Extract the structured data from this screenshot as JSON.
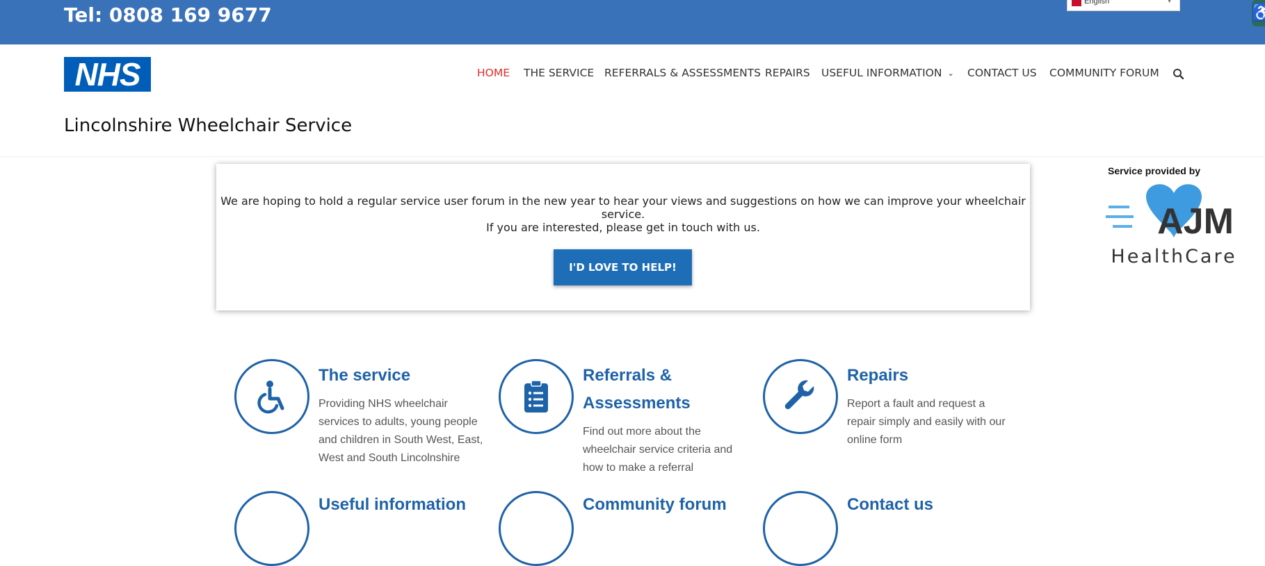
{
  "header": {
    "tel": "Tel: 0808 169 9677",
    "language": "English",
    "logo": "NHS",
    "site_title": "Lincolnshire Wheelchair Service"
  },
  "nav": {
    "items": [
      {
        "label": "HOME",
        "active": true
      },
      {
        "label": "THE SERVICE"
      },
      {
        "label": "REFERRALS & ASSESSMENTS"
      },
      {
        "label": "REPAIRS"
      },
      {
        "label": "USEFUL INFORMATION"
      },
      {
        "label": "CONTACT US"
      },
      {
        "label": "COMMUNITY FORUM"
      }
    ],
    "search_icon": "search-icon"
  },
  "notice": {
    "line1": "We are hoping to hold a regular service user forum in the new year to hear your views and suggestions on how we can improve your wheelchair service.",
    "line2": "If you are interested, please get in touch with us.",
    "button": "I'D LOVE TO HELP!"
  },
  "provider": {
    "label": "Service provided by",
    "logo_text": "AJM",
    "logo_sub": "HealthCare"
  },
  "features": [
    {
      "title": "The service",
      "desc": [
        "Providing NHS wheelchair",
        "services to adults, young people",
        "and children in South West, East,",
        "West and South Lincolnshire"
      ],
      "icon": "wheelchair-icon"
    },
    {
      "title_lines": [
        "Referrals &",
        "Assessments"
      ],
      "desc": [
        "Find out more about the",
        "wheelchair service criteria and",
        "how to make a referral"
      ],
      "icon": "clipboard-icon"
    },
    {
      "title": "Repairs",
      "desc": [
        "Report a fault and request a",
        "repair simply and easily with our",
        "online form"
      ],
      "icon": "wrench-icon"
    },
    {
      "title": "Useful information",
      "icon": "info-icon"
    },
    {
      "title": "Community forum",
      "icon": "forum-icon"
    },
    {
      "title": "Contact us",
      "icon": "contact-icon"
    }
  ],
  "colors": {
    "topbar": "#3a72b9",
    "nhs_blue": "#005eb8",
    "accent_blue": "#1e62a8",
    "active_nav": "#e02b2b"
  }
}
